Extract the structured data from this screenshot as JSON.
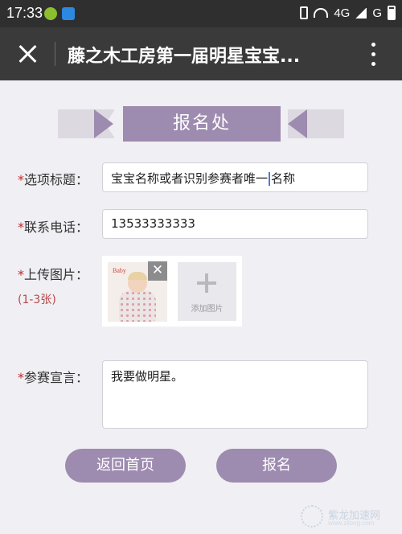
{
  "status_bar": {
    "time": "17:33",
    "network": "4G",
    "network2": "G"
  },
  "header": {
    "title": "藤之木工房第一届明星宝宝..."
  },
  "banner": {
    "title": "报名处"
  },
  "form": {
    "title_label": "选项标题：",
    "title_value_before": "宝宝名称或者识别参赛者唯一",
    "title_value_after": "名称",
    "phone_label": "联系电话：",
    "phone_value": "13533333333",
    "upload_label": "上传图片：",
    "upload_hint": "(1-3张)",
    "upload_add_text": "添加图片",
    "thumb_brand": "Baby",
    "declaration_label": "参赛宣言：",
    "declaration_value": "我要做明星。"
  },
  "buttons": {
    "home": "返回首页",
    "submit": "报名"
  },
  "watermark": {
    "name": "紫龙加速网",
    "url": "www.zilong.com"
  },
  "colors": {
    "accent": "#9e8bb0",
    "required": "#c02a2a",
    "titlebar": "#3a3a3a"
  }
}
